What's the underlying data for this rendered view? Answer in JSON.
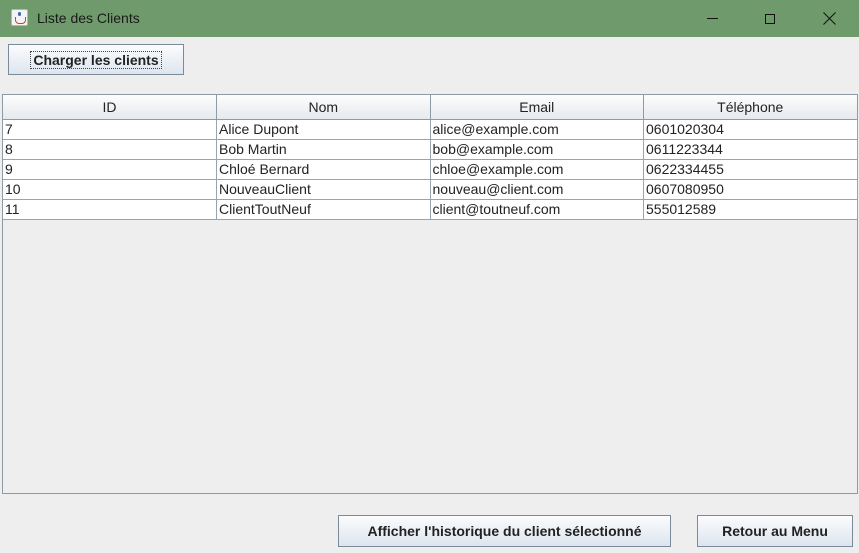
{
  "window": {
    "title": "Liste des Clients"
  },
  "toolbar": {
    "load_label": "Charger les clients"
  },
  "table": {
    "columns": [
      "ID",
      "Nom",
      "Email",
      "Téléphone"
    ],
    "rows": [
      [
        "7",
        "Alice Dupont",
        "alice@example.com",
        "0601020304"
      ],
      [
        "8",
        "Bob Martin",
        "bob@example.com",
        "0611223344"
      ],
      [
        "9",
        "Chloé Bernard",
        "chloe@example.com",
        "0622334455"
      ],
      [
        "10",
        "NouveauClient",
        "nouveau@client.com",
        "0607080950"
      ],
      [
        "11",
        "ClientToutNeuf",
        "client@toutneuf.com",
        "555012589"
      ]
    ]
  },
  "footer": {
    "history_label": "Afficher l'historique du client sélectionné",
    "back_label": "Retour au Menu"
  },
  "colors": {
    "titlebar": "#6f9a6b",
    "background": "#eeeeee"
  }
}
